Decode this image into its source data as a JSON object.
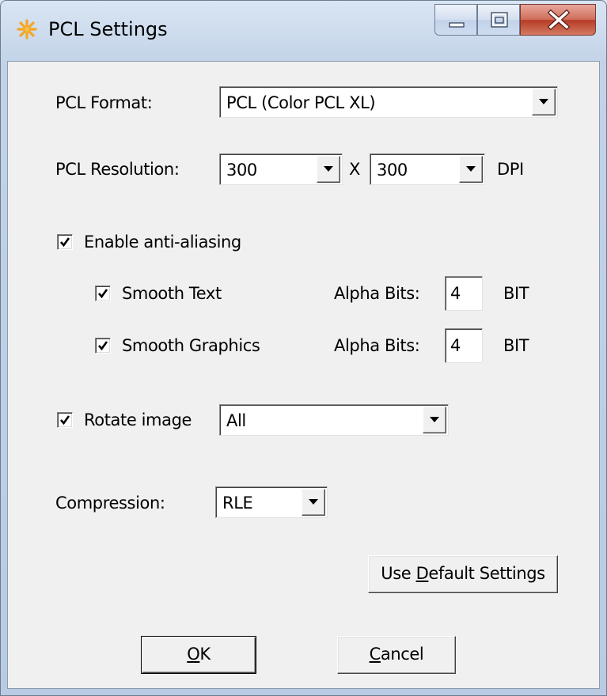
{
  "window": {
    "title": "PCL Settings",
    "app_icon": "sunburst-icon",
    "controls": {
      "minimize": "minimize-icon",
      "maximize": "maximize-icon",
      "close": "close-icon"
    }
  },
  "pcl_format": {
    "label": "PCL Format:",
    "value": "PCL (Color PCL XL)"
  },
  "pcl_resolution": {
    "label": "PCL Resolution:",
    "x_value": "300",
    "separator": "X",
    "y_value": "300",
    "unit": "DPI"
  },
  "anti_aliasing": {
    "label": "Enable anti-aliasing",
    "checked": true,
    "smooth_text": {
      "label": "Smooth Text",
      "checked": true,
      "alpha_label": "Alpha Bits:",
      "alpha_value": "4",
      "unit": "BIT"
    },
    "smooth_graphics": {
      "label": "Smooth Graphics",
      "checked": true,
      "alpha_label": "Alpha Bits:",
      "alpha_value": "4",
      "unit": "BIT"
    }
  },
  "rotate_image": {
    "label": "Rotate image",
    "checked": true,
    "value": "All"
  },
  "compression": {
    "label": "Compression:",
    "value": "RLE"
  },
  "buttons": {
    "use_default": {
      "pre": "Use ",
      "mnemonic": "D",
      "post": "efault Settings"
    },
    "ok": {
      "pre": "",
      "mnemonic": "O",
      "post": "K"
    },
    "cancel": {
      "pre": "",
      "mnemonic": "C",
      "post": "ancel"
    }
  }
}
